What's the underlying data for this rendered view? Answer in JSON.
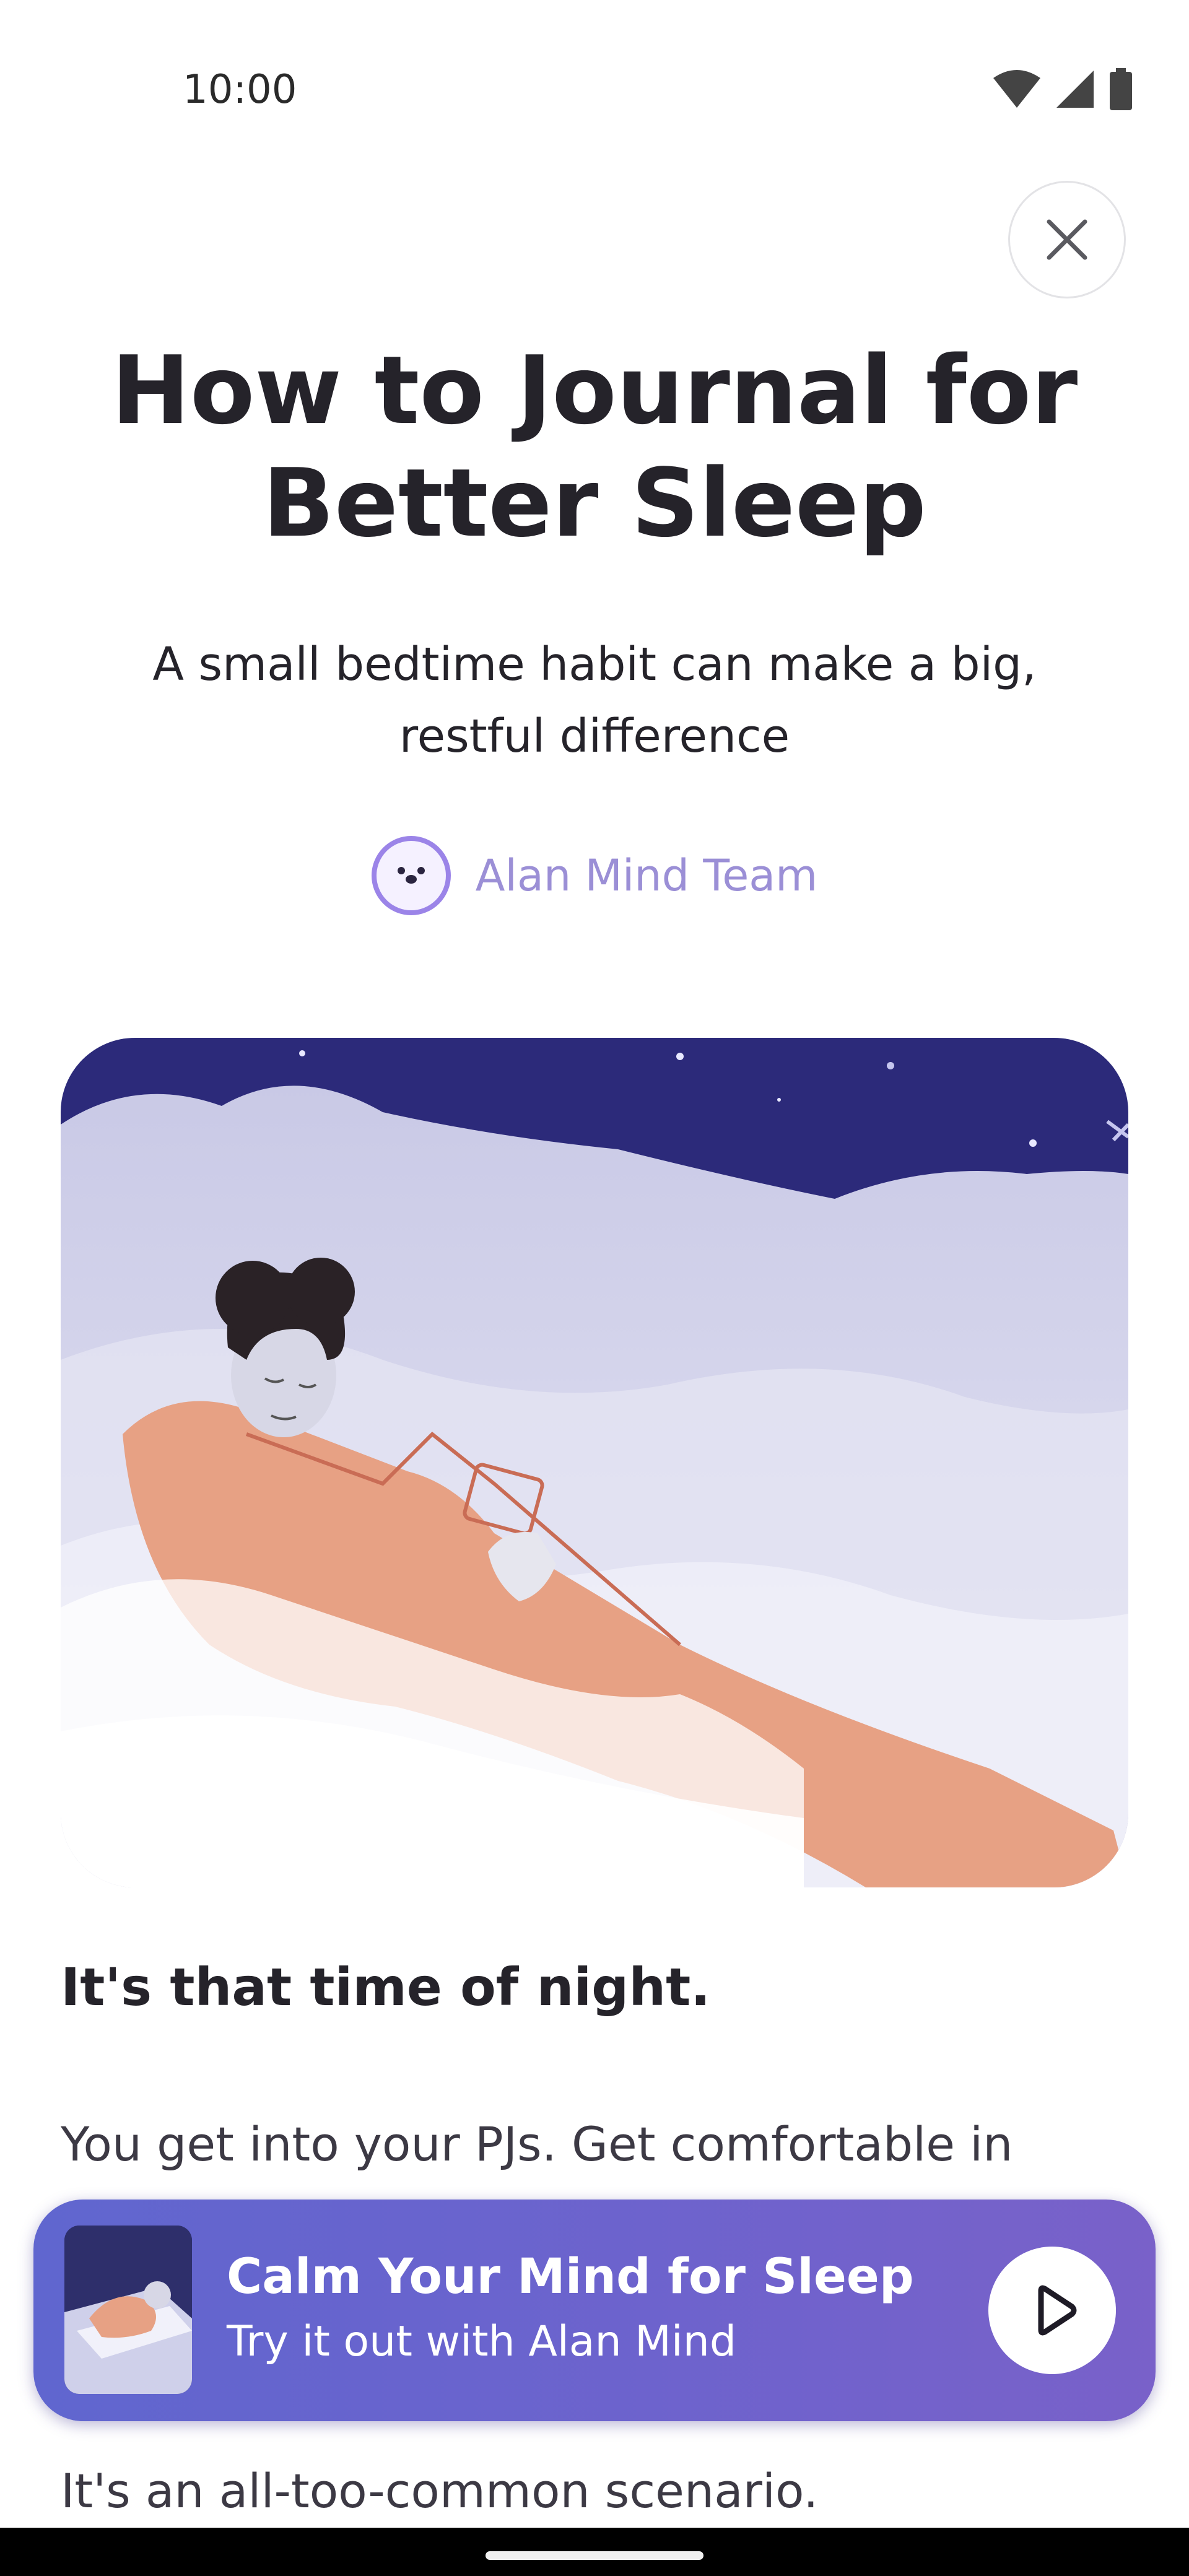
{
  "status_bar": {
    "time": "10:00",
    "icons": [
      "wifi-icon",
      "signal-icon",
      "battery-icon"
    ]
  },
  "header": {
    "close_icon": "close-icon"
  },
  "article": {
    "title": "How to Journal for Better Sleep",
    "subtitle": "A small bedtime habit can make a big, restful difference",
    "author": "Alan Mind Team",
    "section_heading": "It's that time of night.",
    "paragraph_1": "You get into your PJs. Get comfortable in",
    "paragraph_2": "It's an all-too-common scenario."
  },
  "promo": {
    "title": "Calm Your Mind for Sleep",
    "subtitle": "Try it out with Alan Mind",
    "play_icon": "play-icon"
  },
  "colors": {
    "accent_purple": "#6a64cd",
    "author_purple": "#9b8fd6",
    "night_sky": "#2c2a7a"
  }
}
